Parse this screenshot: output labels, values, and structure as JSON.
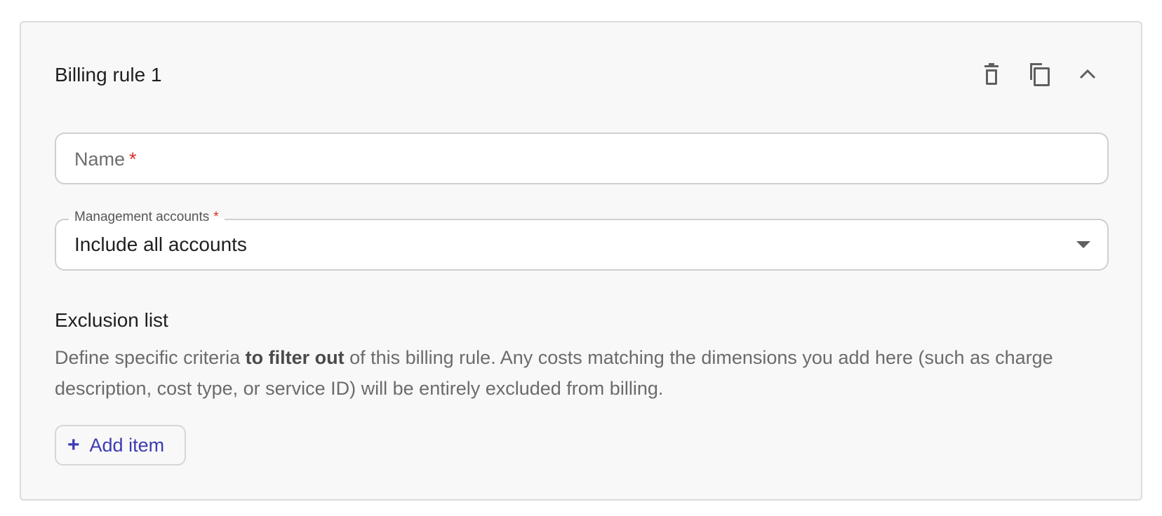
{
  "rule": {
    "title": "Billing rule 1"
  },
  "actions": {
    "delete_icon": "trash-icon",
    "copy_icon": "copy-icon",
    "collapse_icon": "chevron-up-icon"
  },
  "name_field": {
    "placeholder": "Name",
    "required_mark": "*",
    "value": ""
  },
  "management_accounts": {
    "label": "Management accounts",
    "required_mark": "*",
    "selected": "Include all accounts"
  },
  "exclusion": {
    "title": "Exclusion list",
    "description_before": "Define specific criteria ",
    "description_bold": "to filter out",
    "description_after": " of this billing rule. Any costs matching the dimensions you add here (such as charge description, cost type, or service ID) will be entirely excluded from billing.",
    "add_button_label": "Add item",
    "add_button_icon": "plus-icon"
  },
  "colors": {
    "accent": "#3c3bb5",
    "required": "#d93025",
    "card_background": "#f8f8f8"
  }
}
